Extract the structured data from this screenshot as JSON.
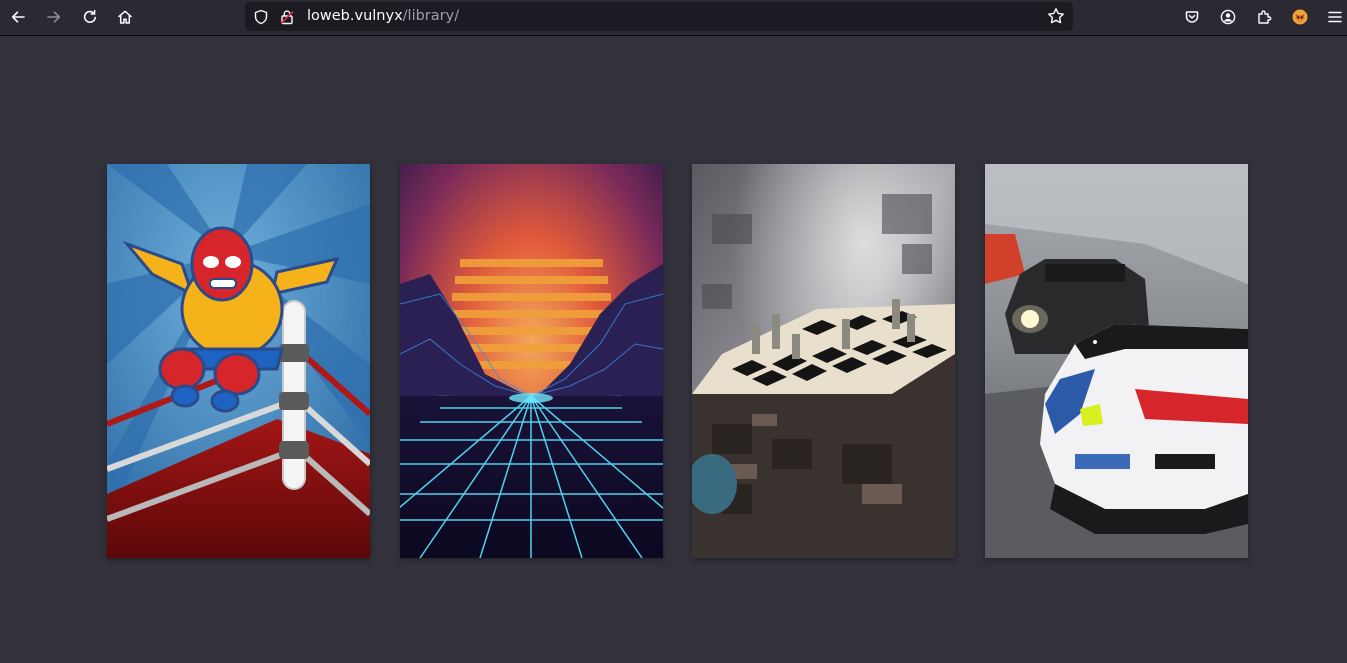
{
  "browser": {
    "url_host": "loweb.vulnyx",
    "url_path": "/library/",
    "colors": {
      "toolbar": "#2b2a33",
      "urlbar": "#1c1b22",
      "page": "#33323c",
      "icon": "#fbfbfe",
      "icon_disabled": "#8f8f9d"
    },
    "icons": {
      "back": "arrow-left-icon",
      "forward": "arrow-right-icon",
      "reload": "reload-icon",
      "home": "home-icon",
      "shield": "shield-icon",
      "lock": "insecure-lock-icon",
      "bookmark": "star-icon",
      "pocket": "pocket-icon",
      "account": "account-icon",
      "extensions": "puzzle-icon",
      "extension_fox": "fox-extension-icon",
      "menu": "hamburger-menu-icon"
    }
  },
  "gallery": {
    "images": [
      {
        "subject": "luchador-wrestler-image"
      },
      {
        "subject": "synthwave-landscape-image"
      },
      {
        "subject": "fractal-chess-image"
      },
      {
        "subject": "race-cars-image"
      }
    ]
  }
}
